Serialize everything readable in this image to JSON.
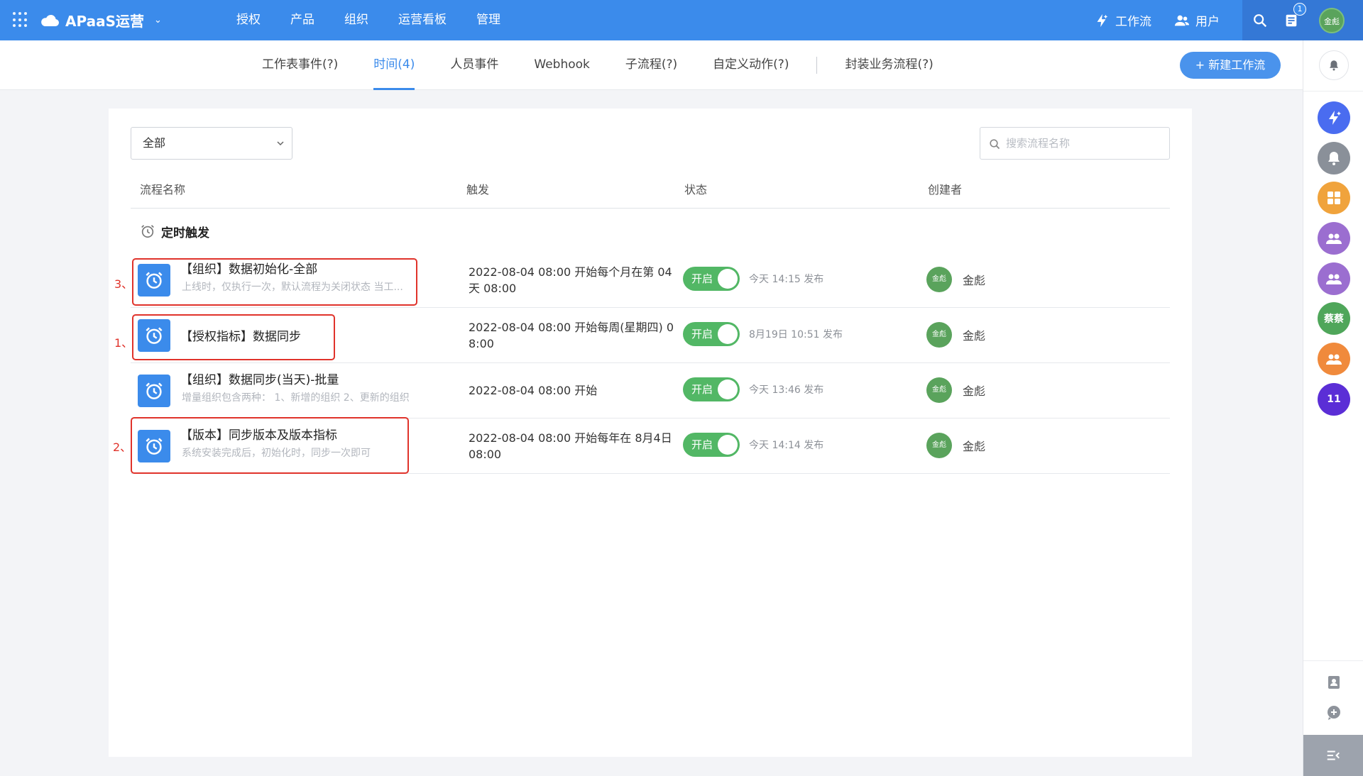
{
  "topbar": {
    "app_name": "APaaS运营",
    "nav": [
      "授权",
      "产品",
      "组织",
      "运营看板",
      "管理"
    ],
    "workflow_label": "工作流",
    "users_label": "用户",
    "notification_count": "1",
    "avatar_text": "金彪"
  },
  "tabs": [
    {
      "label": "工作表事件(?)",
      "active": false
    },
    {
      "label": "时间(4)",
      "active": true
    },
    {
      "label": "人员事件",
      "active": false
    },
    {
      "label": "Webhook",
      "active": false
    },
    {
      "label": "子流程(?)",
      "active": false
    },
    {
      "label": "自定义动作(?)",
      "active": false
    },
    {
      "label": "封装业务流程(?)",
      "active": false
    }
  ],
  "new_button_label": "+ 新建工作流",
  "filter": {
    "selected": "全部"
  },
  "search": {
    "placeholder": "搜索流程名称"
  },
  "columns": {
    "name": "流程名称",
    "trigger": "触发",
    "status": "状态",
    "creator": "创建者"
  },
  "group_title": "定时触发",
  "rows": [
    {
      "name": "【组织】数据初始化-全部",
      "desc": "上线时，仅执行一次，默认流程为关闭状态 当工...",
      "trigger": "2022-08-04 08:00 开始每个月在第 04 天 08:00",
      "status": "开启",
      "published": "今天 14:15 发布",
      "creator_avatar": "金彪",
      "creator": "金彪",
      "annotation": "3、"
    },
    {
      "name": "【授权指标】数据同步",
      "desc": "",
      "trigger": "2022-08-04 08:00 开始每周(星期四) 08:00",
      "status": "开启",
      "published": "8月19日 10:51 发布",
      "creator_avatar": "金彪",
      "creator": "金彪",
      "annotation": "1、"
    },
    {
      "name": "【组织】数据同步(当天)-批量",
      "desc": "增量组织包含两种： 1、新增的组织 2、更新的组织",
      "trigger": "2022-08-04 08:00 开始",
      "status": "开启",
      "published": "今天 13:46 发布",
      "creator_avatar": "金彪",
      "creator": "金彪",
      "annotation": ""
    },
    {
      "name": "【版本】同步版本及版本指标",
      "desc": "系统安装完成后，初始化时，同步一次即可",
      "trigger": "2022-08-04 08:00 开始每年在 8月4日 08:00",
      "status": "开启",
      "published": "今天 14:14 发布",
      "creator_avatar": "金彪",
      "creator": "金彪",
      "annotation": "2、"
    }
  ],
  "sidebar": {
    "contact_label": "蔡蔡",
    "count_label": "11"
  },
  "colors": {
    "primary": "#3b8beb",
    "toggle_on": "#52b765",
    "highlight": "#e0332b"
  }
}
